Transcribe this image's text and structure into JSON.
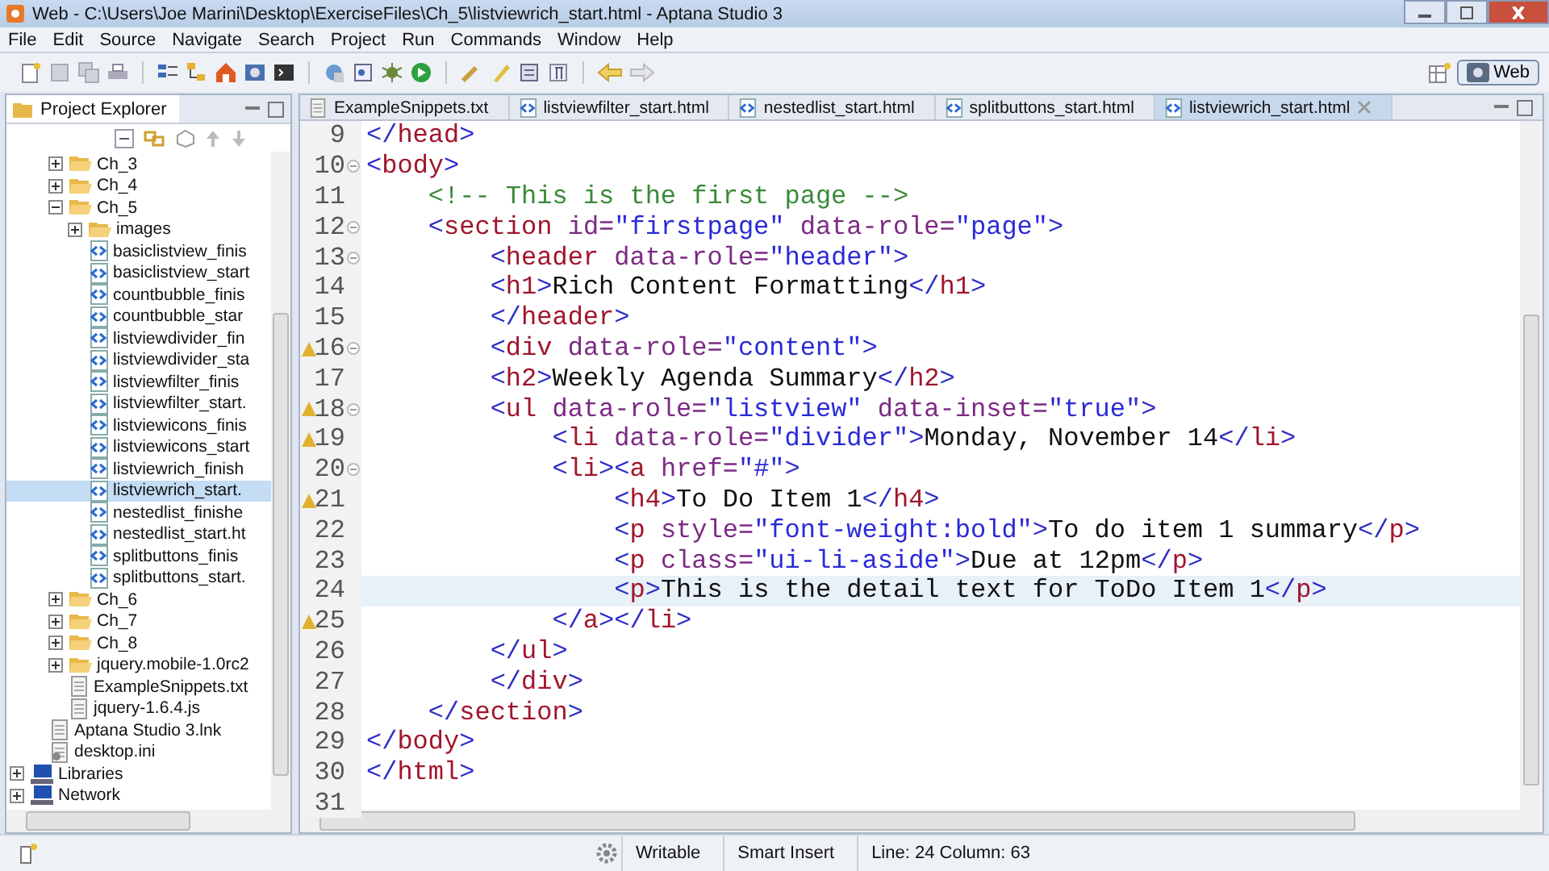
{
  "window": {
    "title": "Web - C:\\Users\\Joe Marini\\Desktop\\ExerciseFiles\\Ch_5\\listviewrich_start.html - Aptana Studio 3"
  },
  "menu": [
    "File",
    "Edit",
    "Source",
    "Navigate",
    "Search",
    "Project",
    "Run",
    "Commands",
    "Window",
    "Help"
  ],
  "perspective": {
    "label": "Web",
    "selected": true
  },
  "explorer": {
    "title": "Project Explorer",
    "items": [
      {
        "children": [
          {
            "children": [
              {
                "label": "Ch_3",
                "kind": "folder",
                "expanded": false,
                "selected": false
              },
              {
                "label": "Ch_4",
                "kind": "folder",
                "expanded": false,
                "selected": false
              },
              {
                "label": "Ch_5",
                "kind": "folder",
                "expanded": true,
                "selected": false,
                "children": [
                  {
                    "label": "images",
                    "kind": "folder",
                    "expanded": false,
                    "selected": false
                  },
                  {
                    "label": "basiclistview_finis",
                    "kind": "html",
                    "selected": false
                  },
                  {
                    "label": "basiclistview_start",
                    "kind": "html",
                    "selected": false
                  },
                  {
                    "label": "countbubble_finis",
                    "kind": "html",
                    "selected": false
                  },
                  {
                    "label": "countbubble_star",
                    "kind": "html",
                    "selected": false
                  },
                  {
                    "label": "listviewdivider_fin",
                    "kind": "html",
                    "selected": false
                  },
                  {
                    "label": "listviewdivider_sta",
                    "kind": "html",
                    "selected": false
                  },
                  {
                    "label": "listviewfilter_finis",
                    "kind": "html",
                    "selected": false
                  },
                  {
                    "label": "listviewfilter_start.",
                    "kind": "html",
                    "selected": false
                  },
                  {
                    "label": "listviewicons_finis",
                    "kind": "html",
                    "selected": false
                  },
                  {
                    "label": "listviewicons_start",
                    "kind": "html",
                    "selected": false
                  },
                  {
                    "label": "listviewrich_finish",
                    "kind": "html",
                    "selected": false
                  },
                  {
                    "label": "listviewrich_start.",
                    "kind": "html",
                    "selected": true
                  },
                  {
                    "label": "nestedlist_finishe",
                    "kind": "html",
                    "selected": false
                  },
                  {
                    "label": "nestedlist_start.ht",
                    "kind": "html",
                    "selected": false
                  },
                  {
                    "label": "splitbuttons_finis",
                    "kind": "html",
                    "selected": false
                  },
                  {
                    "label": "splitbuttons_start.",
                    "kind": "html",
                    "selected": false
                  }
                ]
              },
              {
                "label": "Ch_6",
                "kind": "folder",
                "expanded": false,
                "selected": false
              },
              {
                "label": "Ch_7",
                "kind": "folder",
                "expanded": false,
                "selected": false
              },
              {
                "label": "Ch_8",
                "kind": "folder",
                "expanded": false,
                "selected": false
              },
              {
                "label": "jquery.mobile-1.0rc2",
                "kind": "folder",
                "expanded": false,
                "selected": false
              },
              {
                "label": "ExampleSnippets.txt",
                "kind": "text",
                "selected": false
              },
              {
                "label": "jquery-1.6.4.js",
                "kind": "script",
                "selected": false
              }
            ]
          },
          {
            "label": "Aptana Studio 3.lnk",
            "kind": "text",
            "selected": false
          },
          {
            "label": "desktop.ini",
            "kind": "settings",
            "selected": false
          }
        ]
      },
      {
        "label": "Libraries",
        "kind": "computer",
        "expanded": false,
        "selected": false
      },
      {
        "label": "Network",
        "kind": "computer",
        "expanded": false,
        "selected": false
      }
    ]
  },
  "tabs": [
    {
      "label": "ExampleSnippets.txt",
      "kind": "text",
      "selected": false
    },
    {
      "label": "listviewfilter_start.html",
      "kind": "html",
      "selected": false
    },
    {
      "label": "nestedlist_start.html",
      "kind": "html",
      "selected": false
    },
    {
      "label": "splitbuttons_start.html",
      "kind": "html",
      "selected": false
    },
    {
      "label": "listviewrich_start.html",
      "kind": "html",
      "selected": true
    }
  ],
  "editor": {
    "lines": [
      {
        "number": "9",
        "fold": false,
        "warning": false,
        "current": false,
        "text": "</head>"
      },
      {
        "number": "10",
        "fold": true,
        "warning": false,
        "current": false,
        "text": "<body>"
      },
      {
        "number": "11",
        "fold": false,
        "warning": false,
        "current": false,
        "text": "    <!-- This is the first page -->"
      },
      {
        "number": "12",
        "fold": true,
        "warning": false,
        "current": false,
        "text": "    <section id=\"firstpage\" data-role=\"page\">"
      },
      {
        "number": "13",
        "fold": true,
        "warning": false,
        "current": false,
        "text": "        <header data-role=\"header\">"
      },
      {
        "number": "14",
        "fold": false,
        "warning": false,
        "current": false,
        "text": "        <h1>Rich Content Formatting</h1>"
      },
      {
        "number": "15",
        "fold": false,
        "warning": false,
        "current": false,
        "text": "        </header>"
      },
      {
        "number": "16",
        "fold": true,
        "warning": true,
        "current": false,
        "text": "        <div data-role=\"content\">"
      },
      {
        "number": "17",
        "fold": false,
        "warning": false,
        "current": false,
        "text": "        <h2>Weekly Agenda Summary</h2>"
      },
      {
        "number": "18",
        "fold": true,
        "warning": true,
        "current": false,
        "text": "        <ul data-role=\"listview\" data-inset=\"true\">"
      },
      {
        "number": "19",
        "fold": false,
        "warning": true,
        "current": false,
        "text": "            <li data-role=\"divider\">Monday, November 14</li>"
      },
      {
        "number": "20",
        "fold": true,
        "warning": false,
        "current": false,
        "text": "            <li><a href=\"#\">"
      },
      {
        "number": "21",
        "fold": false,
        "warning": true,
        "current": false,
        "text": "                <h4>To Do Item 1</h4>"
      },
      {
        "number": "22",
        "fold": false,
        "warning": false,
        "current": false,
        "text": "                <p style=\"font-weight:bold\">To do item 1 summary</p>"
      },
      {
        "number": "23",
        "fold": false,
        "warning": false,
        "current": false,
        "text": "                <p class=\"ui-li-aside\">Due at 12pm</p>"
      },
      {
        "number": "24",
        "fold": false,
        "warning": false,
        "current": true,
        "text": "                <p>This is the detail text for ToDo Item 1</p>"
      },
      {
        "number": "25",
        "fold": false,
        "warning": true,
        "current": false,
        "text": "            </a></li>"
      },
      {
        "number": "26",
        "fold": false,
        "warning": false,
        "current": false,
        "text": "        </ul>"
      },
      {
        "number": "27",
        "fold": false,
        "warning": false,
        "current": false,
        "text": "        </div>"
      },
      {
        "number": "28",
        "fold": false,
        "warning": false,
        "current": false,
        "text": "    </section>"
      },
      {
        "number": "29",
        "fold": false,
        "warning": false,
        "current": false,
        "text": "</body>"
      },
      {
        "number": "30",
        "fold": false,
        "warning": false,
        "current": false,
        "text": "</html>"
      },
      {
        "number": "31",
        "fold": false,
        "warning": false,
        "current": false
      }
    ]
  },
  "status_bar": {
    "fields": [
      "Writable",
      "Smart Insert",
      "Line: 24 Column: 63"
    ]
  }
}
